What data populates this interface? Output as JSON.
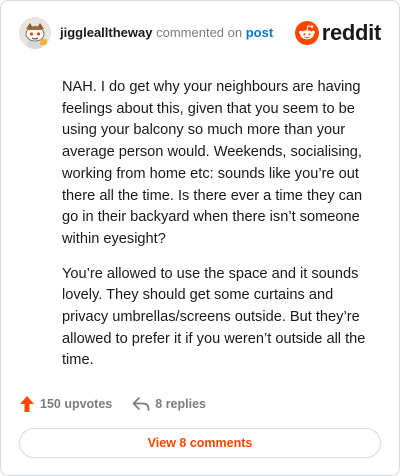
{
  "header": {
    "username": "jigglealltheway",
    "verb": "commented on",
    "post_link": "post",
    "brand": "reddit",
    "brand_color": "#ff4500"
  },
  "comment": {
    "paragraphs": [
      "NAH. I do get why your neighbours are having feelings about this, given that you seem to be using your balcony so much more than your average person would. Weekends, socialising, working from home etc: sounds like you’re out there all the time. Is there ever a time they can go in their backyard when there isn’t someone within eyesight?",
      "You’re allowed to use the space and it sounds lovely. They should get some curtains and privacy umbrellas/screens outside. But they’re allowed to prefer it if you weren’t outside all the time."
    ]
  },
  "actions": {
    "upvotes_label": "150 upvotes",
    "replies_label": "8 replies"
  },
  "footer": {
    "view_comments_label": "View 8 comments"
  },
  "icons": {
    "avatar": "snoo-avatar-icon",
    "brand": "reddit-logo-icon",
    "upvote": "upvote-arrow-icon",
    "reply": "reply-arrow-icon"
  }
}
